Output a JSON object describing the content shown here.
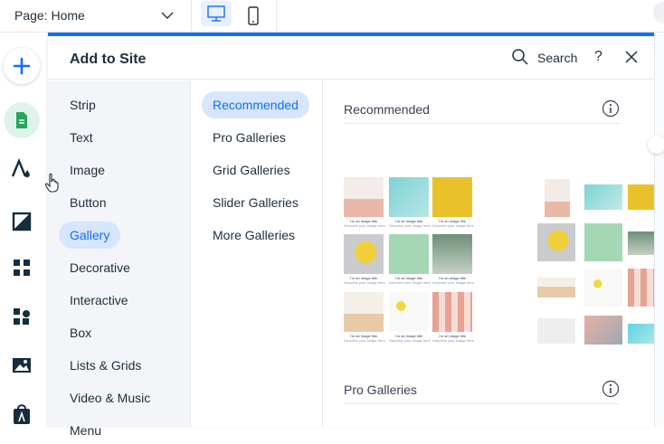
{
  "topbar": {
    "page_label": "Page:",
    "page_name": "Home"
  },
  "panel": {
    "title": "Add to Site",
    "search_label": "Search",
    "help_label": "?"
  },
  "categories": [
    {
      "label": "Strip"
    },
    {
      "label": "Text"
    },
    {
      "label": "Image"
    },
    {
      "label": "Button"
    },
    {
      "label": "Gallery",
      "active": true
    },
    {
      "label": "Decorative"
    },
    {
      "label": "Interactive"
    },
    {
      "label": "Box"
    },
    {
      "label": "Lists & Grids"
    },
    {
      "label": "Video & Music"
    },
    {
      "label": "Menu"
    }
  ],
  "subcategories": [
    {
      "label": "Recommended",
      "active": true
    },
    {
      "label": "Pro Galleries"
    },
    {
      "label": "Grid Galleries"
    },
    {
      "label": "Slider Galleries"
    },
    {
      "label": "More Galleries"
    }
  ],
  "sections": [
    {
      "title": "Recommended"
    },
    {
      "title": "Pro Galleries"
    }
  ],
  "gallery_captions": {
    "title": "I'm an image title",
    "desc": "Describe your image here"
  },
  "colors": {
    "accent": "#116dff",
    "active_bg": "#d6e6fe",
    "pages_bg": "#dff3ea",
    "pages_green": "#25a55f"
  }
}
